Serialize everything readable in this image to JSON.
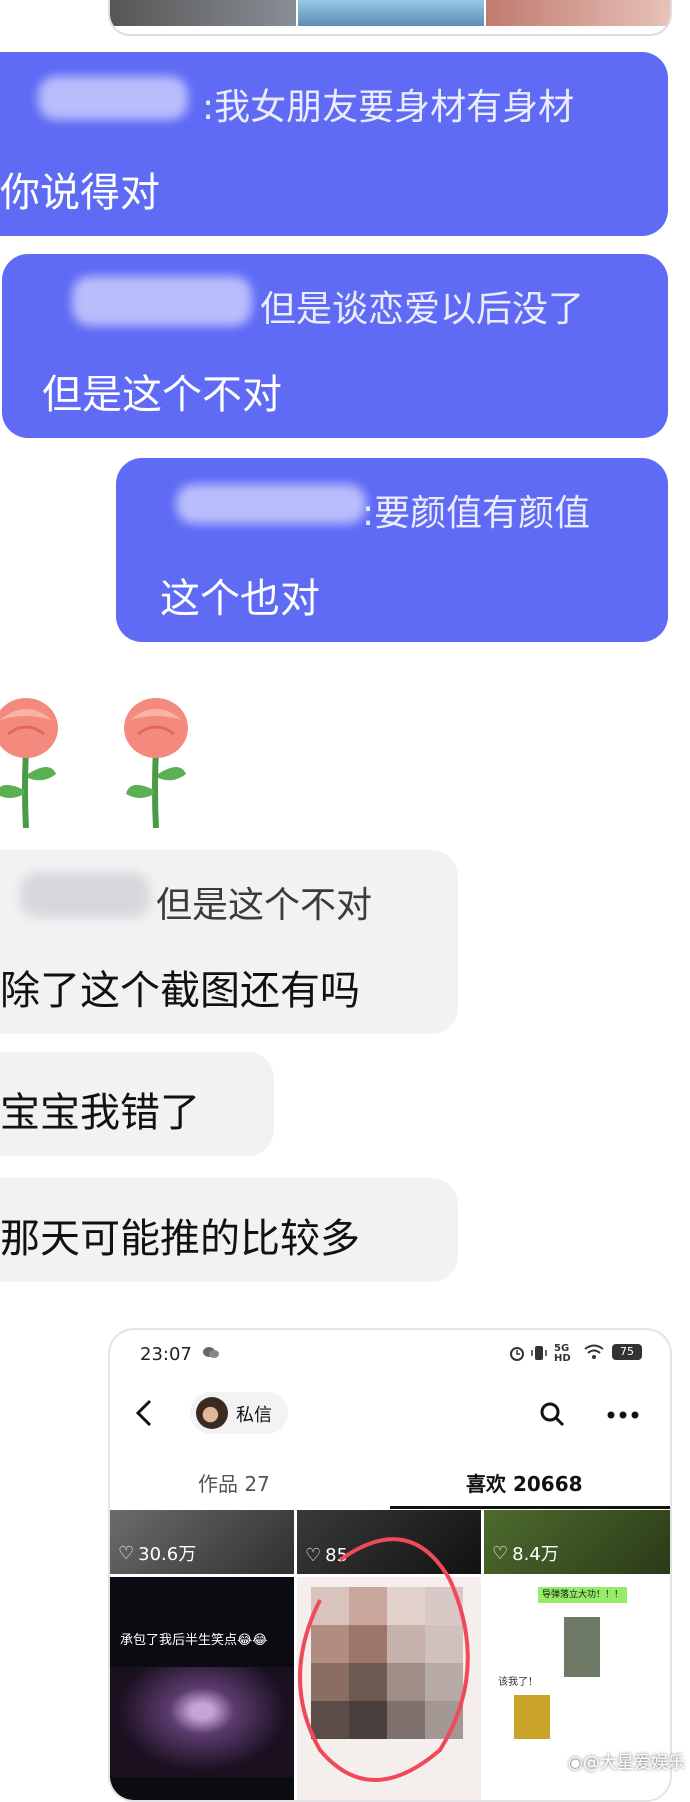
{
  "chat": {
    "msg1": {
      "quote": ":我女朋友要身材有身材",
      "text": "你说得对"
    },
    "msg2": {
      "quote": "但是谈恋爱以后没了",
      "text": "但是这个不对"
    },
    "msg3": {
      "quote": ":要颜值有颜值",
      "text": "这个也对"
    },
    "msg4": {
      "quote": "但是这个不对",
      "text": "除了这个截图还有吗"
    },
    "msg5": {
      "text": "宝宝我错了"
    },
    "msg6": {
      "text": "那天可能推的比较多"
    }
  },
  "embedded_screenshot": {
    "time": "23:07",
    "network": "5G HD",
    "battery": "75",
    "dm_label": "私信",
    "tab_works": "作品 27",
    "tab_likes": "喜欢 20668",
    "thumbs": [
      {
        "likes": "30.6万"
      },
      {
        "likes": "85"
      },
      {
        "likes": "8.4万"
      }
    ],
    "video_caption": "承包了我后半生笑点😂😂",
    "chat_thumb_green": "导弹落立大功！！！",
    "chat_thumb_text": "该我了！"
  },
  "watermark": "@大星爱娱乐",
  "colors": {
    "accent": "#5f6af5",
    "grey_bubble": "#f2f2f4"
  }
}
